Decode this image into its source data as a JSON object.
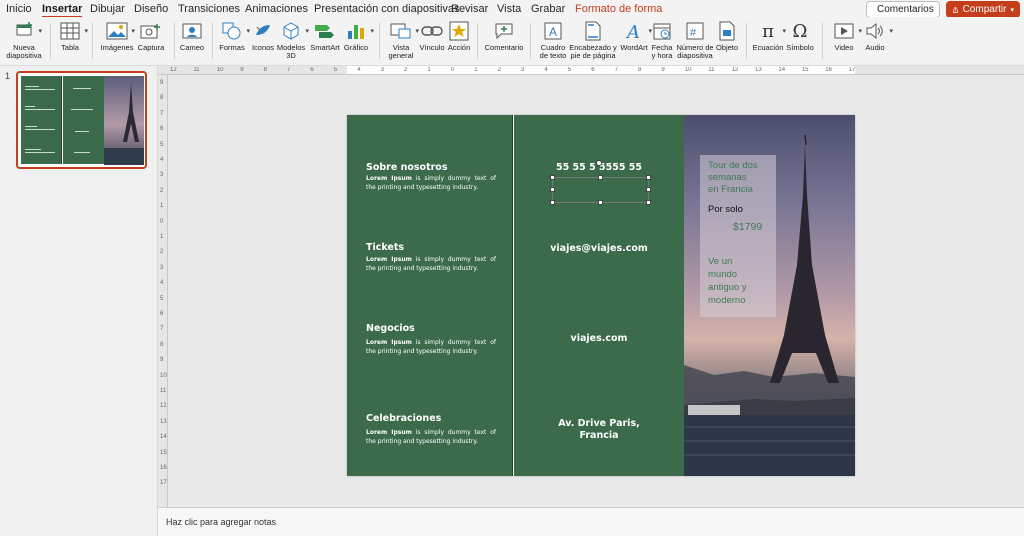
{
  "menu": {
    "tabs": [
      "Inicio",
      "Insertar",
      "Dibujar",
      "Diseño",
      "Transiciones",
      "Animaciones",
      "Presentación con diapositivas",
      "Revisar",
      "Vista",
      "Grabar",
      "Formato de forma"
    ],
    "active": "Insertar",
    "comments_label": "Comentarios",
    "share_label": "Compartir"
  },
  "ribbon": {
    "nueva": "Nueva\ndiapositiva",
    "tabla": "Tabla",
    "imagenes": "Imágenes",
    "captura": "Captura",
    "cameo": "Cameo",
    "formas": "Formas",
    "iconos": "Iconos",
    "modelos": "Modelos\n3D",
    "smartart": "SmartArt",
    "grafico": "Gráfico",
    "vista": "Vista\ngeneral",
    "vinculo": "Vínculo",
    "accion": "Acción",
    "comentario": "Comentario",
    "cuadro": "Cuadro\nde texto",
    "encabezado": "Encabezado y\npie de página",
    "wordart": "WordArt",
    "fecha": "Fecha\ny hora",
    "numero": "Número de\ndiapositiva",
    "objeto": "Objeto",
    "ecuacion": "Ecuación",
    "simbolo": "Símbolo",
    "video": "Video",
    "audio": "Audio"
  },
  "thumbnail": {
    "number": "1"
  },
  "slide": {
    "sections": [
      {
        "title": "Sobre nosotros",
        "lead": "Lorem Ipsum",
        "body": " is simply dummy text of the printing and typesetting industry."
      },
      {
        "title": "Tickets",
        "lead": "Lorem Ipsum",
        "body": " is simply dummy text of the printing and typesetting industry."
      },
      {
        "title": "Negocios",
        "lead": "Lorem Ipsum",
        "body": " is simply dummy text of the printing and typesetting industry."
      },
      {
        "title": "Celebraciones",
        "lead": "Lorem Ipsum",
        "body": " is simply dummy text of the printing and typesetting industry."
      }
    ],
    "phone": "55 55 5 5555 55",
    "email": "viajes@viajes.com",
    "web": "viajes.com",
    "address_line1": "Av. Drive Paris,",
    "address_line2": "Francia",
    "promo": {
      "tour_l1": "Tour de dos",
      "tour_l2": "semanas",
      "tour_l3": "en Francia",
      "por_solo": "Por solo",
      "price": "$1799",
      "tag_l1": "Ve un",
      "tag_l2": "mundo",
      "tag_l3": "antiguo y",
      "tag_l4": "moderno"
    }
  },
  "notes_placeholder": "Haz clic para agregar notas",
  "colors": {
    "accent": "#c43e1c",
    "panel_green": "#3b6b4b",
    "promo_green": "#3f7a52"
  },
  "ruler": {
    "h_ticks": [
      "12",
      "11",
      "10",
      "9",
      "8",
      "7",
      "6",
      "5",
      "4",
      "3",
      "2",
      "1",
      "0",
      "1",
      "2",
      "3",
      "4",
      "5",
      "6",
      "7",
      "8",
      "9",
      "10",
      "11",
      "12",
      "13",
      "14",
      "15",
      "16",
      "17"
    ],
    "v_ticks": [
      "9",
      "8",
      "7",
      "6",
      "5",
      "4",
      "3",
      "2",
      "1",
      "0",
      "1",
      "2",
      "3",
      "4",
      "5",
      "6",
      "7",
      "8",
      "9",
      "10",
      "11",
      "12",
      "13",
      "14",
      "15",
      "16",
      "17"
    ]
  }
}
